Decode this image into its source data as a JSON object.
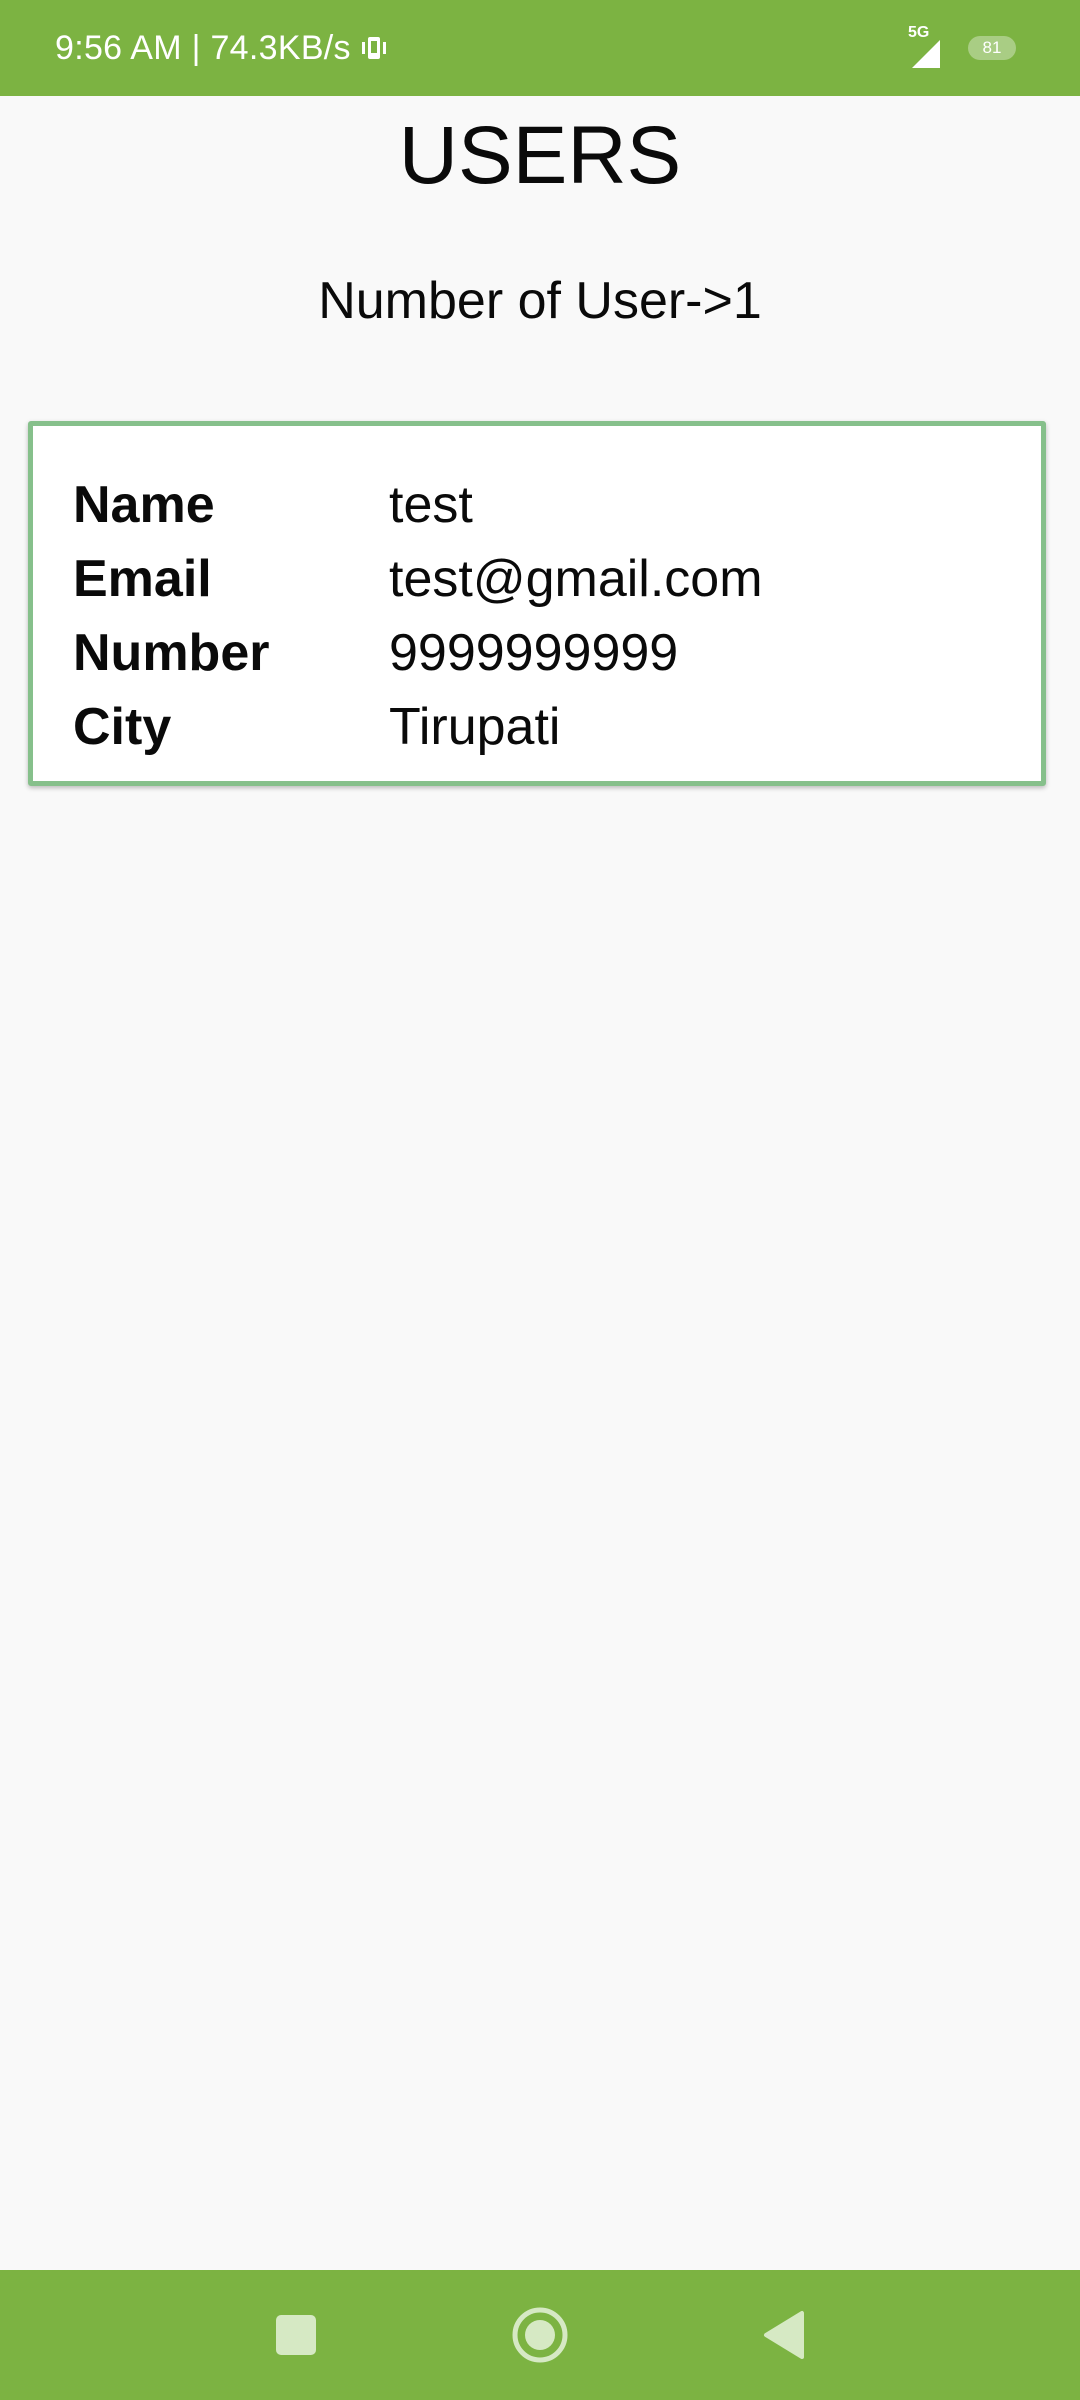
{
  "status_bar": {
    "time_speed": "9:56 AM | 74.3KB/s",
    "network_type": "5G",
    "battery_level": "81"
  },
  "page": {
    "title": "USERS",
    "count_text": "Number of User->1"
  },
  "users": [
    {
      "fields": [
        {
          "label": "Name",
          "value": "test"
        },
        {
          "label": "Email",
          "value": "test@gmail.com"
        },
        {
          "label": "Number",
          "value": "9999999999"
        },
        {
          "label": "City",
          "value": "Tirupati"
        }
      ]
    }
  ],
  "nav_bar": {
    "buttons": [
      "recent-apps-icon",
      "home-icon",
      "back-icon"
    ]
  },
  "colors": {
    "accent": "#7cb342",
    "card_border": "#86c08b",
    "background": "#f9f9f9"
  }
}
